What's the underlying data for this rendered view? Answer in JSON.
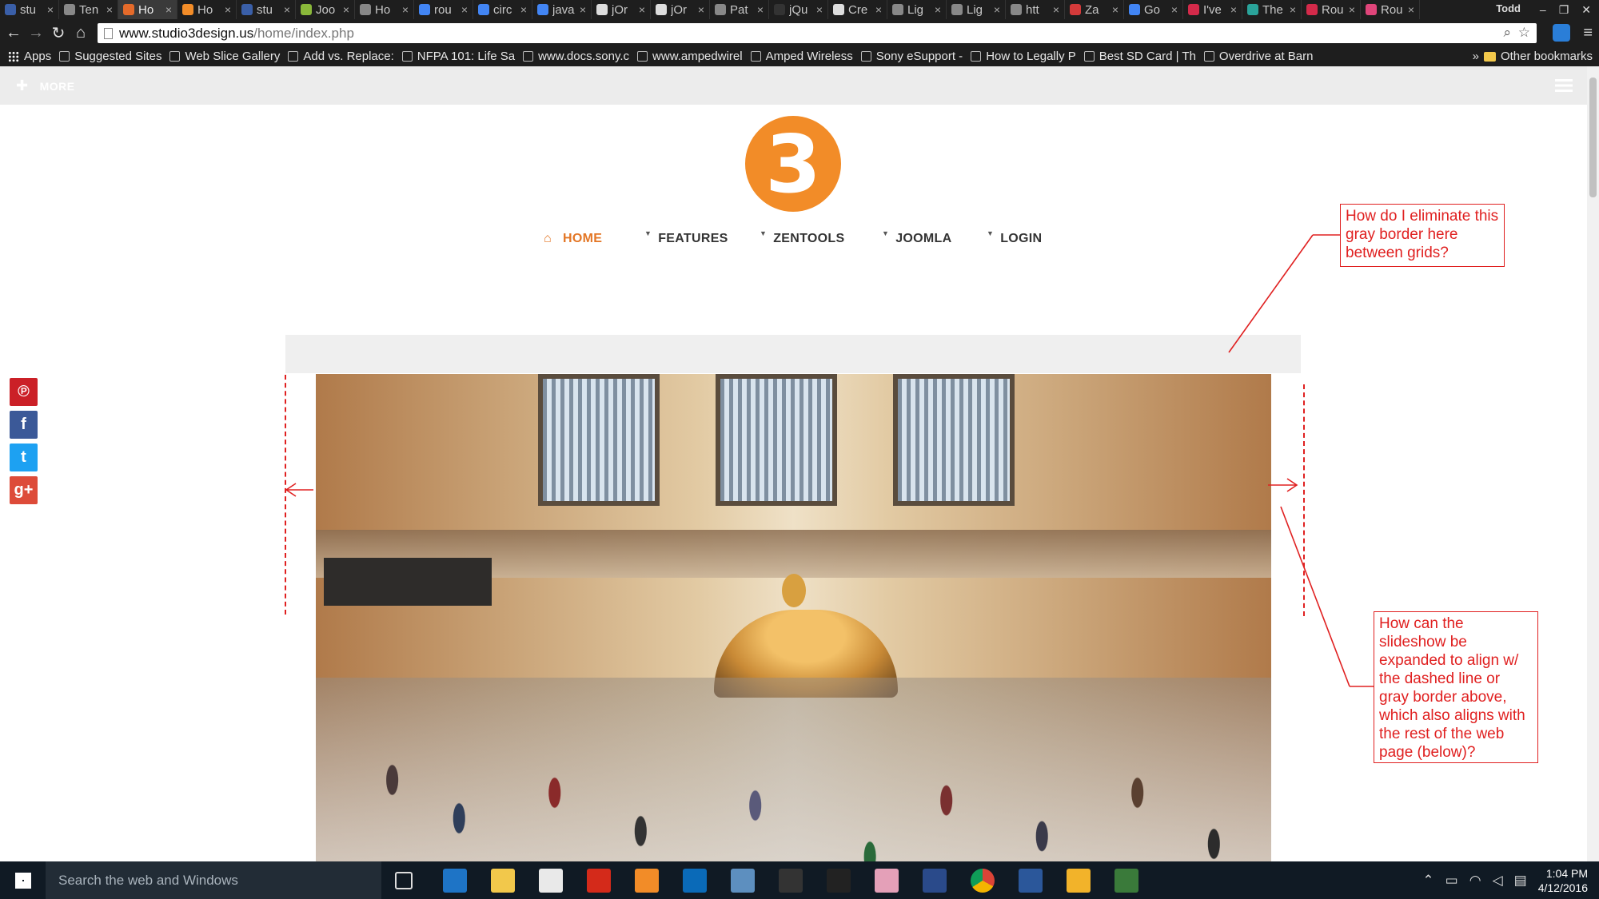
{
  "browser": {
    "tabs": [
      {
        "title": "stu",
        "color": "#3a5fa8"
      },
      {
        "title": "Ten",
        "color": "#888888"
      },
      {
        "title": "Ho",
        "color": "#e46a2a",
        "active": true
      },
      {
        "title": "Ho",
        "color": "#f28c28"
      },
      {
        "title": "stu",
        "color": "#3a5fa8"
      },
      {
        "title": "Joo",
        "color": "#8ab83a"
      },
      {
        "title": "Ho",
        "color": "#888888"
      },
      {
        "title": "rou",
        "color": "#4285f4"
      },
      {
        "title": "circ",
        "color": "#4285f4"
      },
      {
        "title": "java",
        "color": "#4285f4"
      },
      {
        "title": "jOr",
        "color": "#dddddd"
      },
      {
        "title": "jOr",
        "color": "#dddddd"
      },
      {
        "title": "Pat",
        "color": "#888888"
      },
      {
        "title": "jQu",
        "color": "#333333"
      },
      {
        "title": "Cre",
        "color": "#dddddd"
      },
      {
        "title": "Lig",
        "color": "#888888"
      },
      {
        "title": "Lig",
        "color": "#888888"
      },
      {
        "title": "htt",
        "color": "#888888"
      },
      {
        "title": "Za",
        "color": "#d43a3a"
      },
      {
        "title": "Go",
        "color": "#4285f4"
      },
      {
        "title": "I've",
        "color": "#d42a4a"
      },
      {
        "title": "The",
        "color": "#2aa39a"
      },
      {
        "title": "Rou",
        "color": "#d42a4a"
      },
      {
        "title": "Rou",
        "color": "#e0457a"
      }
    ],
    "tab_close": "×",
    "user": "Todd",
    "window_controls": {
      "minimize": "–",
      "restore": "❐",
      "close": "✕"
    },
    "url_host": "www.studio3design.us",
    "url_path": "/home/index.php",
    "nav": {
      "back": "←",
      "forward": "→",
      "reload": "↻",
      "home": "⌂"
    },
    "bookmarks": [
      {
        "label": "Apps",
        "kind": "apps"
      },
      {
        "label": "Suggested Sites"
      },
      {
        "label": "Web Slice Gallery"
      },
      {
        "label": "Add vs. Replace:"
      },
      {
        "label": "NFPA 101: Life Sa"
      },
      {
        "label": "www.docs.sony.c"
      },
      {
        "label": "www.ampedwirel"
      },
      {
        "label": "Amped Wireless"
      },
      {
        "label": "Sony eSupport -"
      },
      {
        "label": "How to Legally P"
      },
      {
        "label": "Best SD Card | Th"
      },
      {
        "label": "Overdrive at Barn"
      }
    ],
    "bookmarks_overflow": "»",
    "other_bookmarks": "Other bookmarks"
  },
  "site": {
    "more_label": "MORE",
    "logo_text": "3",
    "logo_color": "#f28c28",
    "accent": "#e37625",
    "menu": [
      {
        "label": "HOME",
        "active": true
      },
      {
        "label": "FEATURES",
        "dropdown": true
      },
      {
        "label": "ZENTOOLS",
        "dropdown": true
      },
      {
        "label": "JOOMLA",
        "dropdown": true
      },
      {
        "label": "LOGIN",
        "dropdown": true
      }
    ],
    "social": [
      {
        "name": "pinterest",
        "glyph": "℗",
        "color": "#cb2027"
      },
      {
        "name": "facebook",
        "glyph": "f",
        "color": "#3b5998"
      },
      {
        "name": "twitter",
        "glyph": "t",
        "color": "#1da1f2"
      },
      {
        "name": "google-plus",
        "glyph": "g+",
        "color": "#dd4b39"
      }
    ]
  },
  "annotations": {
    "top": "How do I eliminate this gray border here between grids?",
    "right": "How can the slideshow be expanded to align w/ the dashed line or gray border above, which also aligns with the rest of the web page (below)?",
    "color": "#e02020"
  },
  "taskbar": {
    "search_placeholder": "Search the web and Windows",
    "apps": [
      "task-view",
      "edge",
      "file-explorer",
      "store",
      "acrobat",
      "media-player",
      "outlook",
      "app-blue",
      "app-dark",
      "timer",
      "paint",
      "powershell",
      "chrome",
      "word",
      "photos",
      "visio"
    ],
    "time": "1:04 PM",
    "date": "4/12/2016"
  }
}
